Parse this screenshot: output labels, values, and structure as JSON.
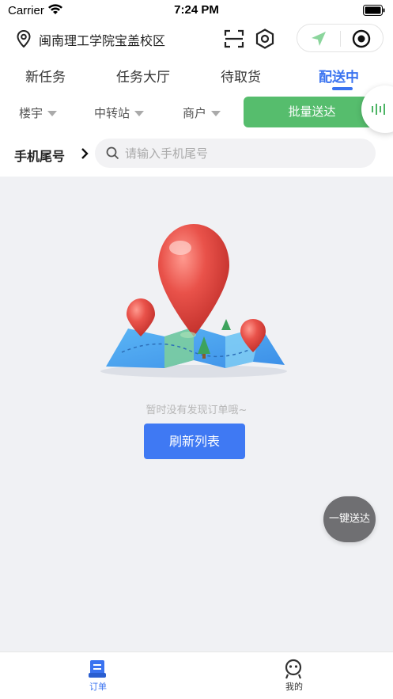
{
  "status_bar": {
    "carrier": "Carrier",
    "time": "7:24 PM",
    "icons": [
      "wifi-icon",
      "battery-icon"
    ]
  },
  "header": {
    "location": "闽南理工学院宝盖校区",
    "icons": [
      "location-pin-icon",
      "scan-icon",
      "target-icon",
      "navigation-arrow-icon",
      "record-icon"
    ]
  },
  "tabs": [
    {
      "label": "新任务",
      "active": false
    },
    {
      "label": "任务大厅",
      "active": false
    },
    {
      "label": "待取货",
      "active": false
    },
    {
      "label": "配送中",
      "active": true
    }
  ],
  "filters": [
    {
      "label": "楼宇"
    },
    {
      "label": "中转站"
    },
    {
      "label": "商户"
    }
  ],
  "batch_button": "批量送达",
  "search": {
    "label": "手机尾号",
    "placeholder": "请输入手机尾号",
    "value": ""
  },
  "empty": {
    "message": "暂时没有发现订单哦~",
    "refresh_label": "刷新列表"
  },
  "one_key_button": "一键送达",
  "tabbar": [
    {
      "label": "订单",
      "icon": "order-icon",
      "active": true
    },
    {
      "label": "我的",
      "icon": "profile-icon",
      "active": false
    }
  ],
  "colors": {
    "accent": "#3a73f0",
    "batch_green": "#56bd6d",
    "refresh_blue": "#3f79f3",
    "float_gray": "#6f6f72"
  }
}
